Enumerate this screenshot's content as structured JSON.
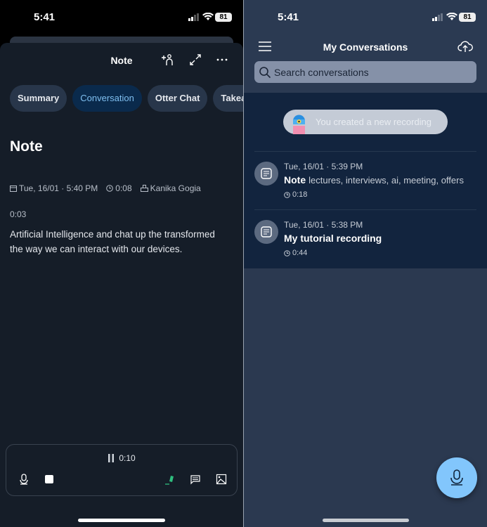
{
  "status_bar": {
    "time": "5:41",
    "battery": "81"
  },
  "note_screen": {
    "title": "Note",
    "tabs": [
      {
        "label": "Summary"
      },
      {
        "label": "Conversation",
        "active": true
      },
      {
        "label": "Otter Chat"
      },
      {
        "label": "Takeaw"
      }
    ],
    "heading": "Note",
    "meta": {
      "date": "Tue, 16/01 · 5:40 PM",
      "duration": "0:08",
      "owner": "Kanika Gogia"
    },
    "transcript": {
      "timestamp": "0:03",
      "text": "Artificial Intelligence and chat up the transformed the way we can interact with our devices."
    },
    "recorder": {
      "elapsed": "0:10",
      "highlight_color": "#2fbf7f"
    }
  },
  "conversations_screen": {
    "title": "My Conversations",
    "search_placeholder": "Search conversations",
    "toast": "You created a new recording",
    "items": [
      {
        "date": "Tue, 16/01 · 5:39 PM",
        "title": "Note",
        "keywords": "lectures, interviews, ai, meeting, offers",
        "duration": "0:18"
      },
      {
        "date": "Tue, 16/01 · 5:38 PM",
        "title": "My tutorial recording",
        "keywords": "",
        "duration": "0:44"
      }
    ],
    "fab_color": "#82c6fc"
  }
}
